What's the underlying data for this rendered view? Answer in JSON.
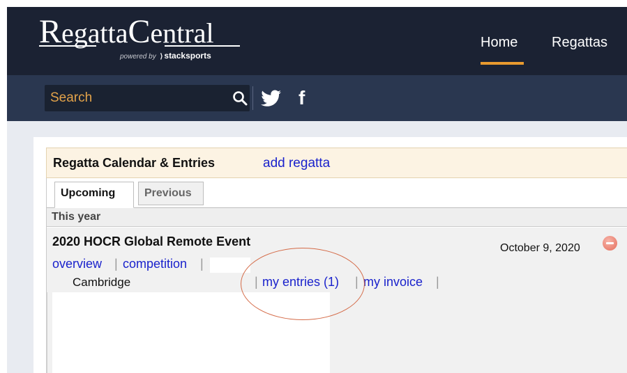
{
  "header": {
    "logo_text": "RegattaCentral",
    "powered_by": "powered by",
    "powered_brand": "stacksports",
    "nav": {
      "home": "Home",
      "regattas": "Regattas"
    },
    "colors": {
      "header_bg": "#1b2233",
      "subbar_bg": "#2a3750",
      "nav_active_underline": "#e89a2f",
      "search_text": "#e3a34a"
    }
  },
  "search": {
    "label": "Search",
    "icon": "search-icon"
  },
  "social": {
    "twitter_icon": "twitter-icon",
    "facebook_icon": "facebook-icon",
    "facebook_glyph": "f"
  },
  "calendar": {
    "title": "Regatta Calendar & Entries",
    "add_link": "add regatta",
    "tabs": [
      {
        "label": "Upcoming",
        "active": true
      },
      {
        "label": "Previous",
        "active": false
      }
    ],
    "section_label": "This year",
    "events": [
      {
        "name": "2020 HOCR Global Remote Event",
        "date": "October 9, 2020",
        "location": "Cambridge",
        "links": {
          "overview": "overview",
          "competition": "competition",
          "my_entries": "my entries (1)",
          "my_invoice": "my invoice"
        },
        "separator": "|"
      }
    ],
    "colors": {
      "link": "#1a22cc",
      "header_bg": "#fcf3e3",
      "annotation": "#d46a47"
    }
  }
}
